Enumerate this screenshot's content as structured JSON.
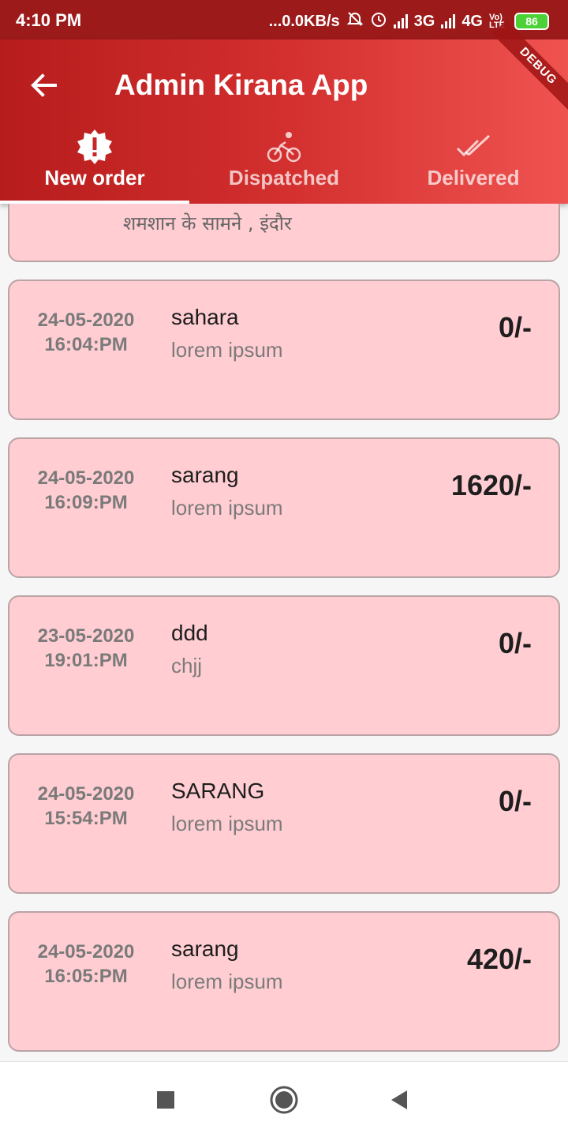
{
  "status_bar": {
    "time": "4:10 PM",
    "net_speed": "...0.0KB/s",
    "net1": "3G",
    "net2": "4G",
    "volte": "Vo) LTE",
    "battery": "86",
    "icons": [
      "mute-icon",
      "alarm-icon",
      "signal-icon",
      "battery-icon"
    ]
  },
  "app_bar": {
    "title": "Admin Kirana App",
    "back_icon": "arrow-back-icon",
    "debug_banner": "DEBUG",
    "background": "#c62828"
  },
  "tabs": [
    {
      "label": "New order",
      "icon": "new-order-badge-icon",
      "active": true
    },
    {
      "label": "Dispatched",
      "icon": "bicycle-icon",
      "active": false
    },
    {
      "label": "Delivered",
      "icon": "double-check-icon",
      "active": false
    }
  ],
  "orders": {
    "partial_address": "शमशान के सामने , इंदौर",
    "items": [
      {
        "date": "24-05-2020",
        "time": "16:04:PM",
        "name": "sahara",
        "desc": "lorem ipsum",
        "amount": "0/-"
      },
      {
        "date": "24-05-2020",
        "time": "16:09:PM",
        "name": "sarang",
        "desc": "lorem ipsum",
        "amount": "1620/-"
      },
      {
        "date": "23-05-2020",
        "time": "19:01:PM",
        "name": "ddd",
        "desc": "chjj",
        "amount": "0/-"
      },
      {
        "date": "24-05-2020",
        "time": "15:54:PM",
        "name": "SARANG",
        "desc": "lorem ipsum",
        "amount": "0/-"
      },
      {
        "date": "24-05-2020",
        "time": "16:05:PM",
        "name": "sarang",
        "desc": "lorem ipsum",
        "amount": "420/-"
      }
    ]
  },
  "colors": {
    "card_bg": "#ffcdd2",
    "accent": "#d32f2f"
  },
  "nav": {
    "buttons": [
      "recent-apps-icon",
      "home-icon",
      "back-triangle-icon"
    ]
  }
}
